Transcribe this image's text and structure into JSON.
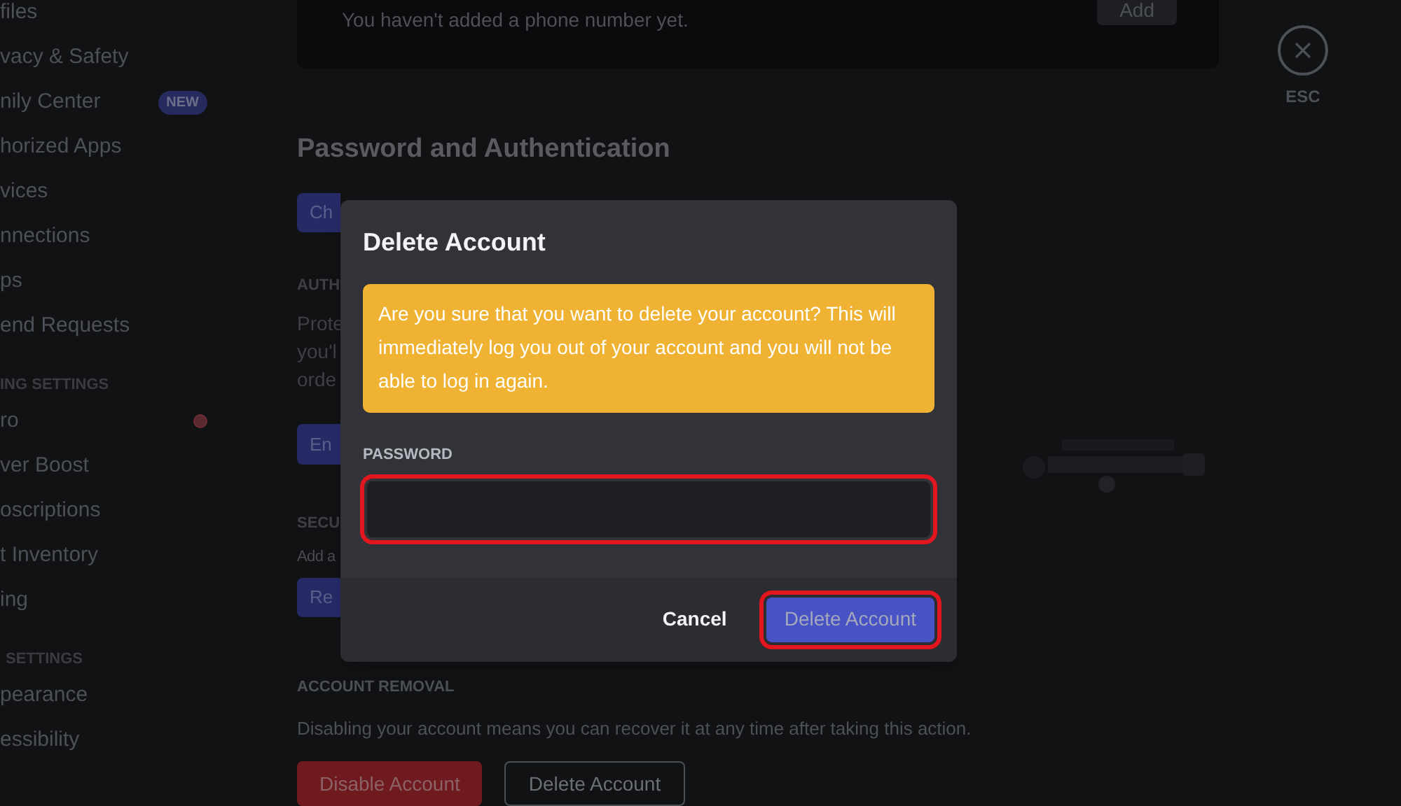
{
  "sidebar": {
    "sections": [
      {
        "items": [
          {
            "label": "files"
          },
          {
            "label": "vacy & Safety"
          },
          {
            "label": "nily Center",
            "badge": "NEW"
          },
          {
            "label": "horized Apps"
          },
          {
            "label": "vices"
          },
          {
            "label": "nnections"
          },
          {
            "label": "ps"
          },
          {
            "label": "end Requests"
          }
        ]
      },
      {
        "header": "ING SETTINGS",
        "items": [
          {
            "label": "ro",
            "alert": true
          },
          {
            "label": "ver Boost"
          },
          {
            "label": "oscriptions"
          },
          {
            "label": "t Inventory"
          },
          {
            "label": "ing"
          }
        ]
      },
      {
        "header": "SETTINGS",
        "items": [
          {
            "label": "pearance"
          },
          {
            "label": "essibility"
          }
        ]
      }
    ]
  },
  "phone_card": {
    "text": "You haven't added a phone number yet.",
    "button": "Add"
  },
  "close": {
    "label": "ESC"
  },
  "password_section": {
    "title": "Password and Authentication",
    "button": "Ch",
    "auth_label": "AUTH",
    "auth_text": [
      "Prote",
      "you'l",
      "orde"
    ],
    "enable_button": "En",
    "security_label": "SECU",
    "security_text": "Add a",
    "security_button": "Re"
  },
  "account_removal": {
    "label": "ACCOUNT REMOVAL",
    "text": "Disabling your account means you can recover it at any time after taking this action.",
    "buttons": [
      {
        "label": "Disable Account",
        "kind": "danger"
      },
      {
        "label": "Delete Account",
        "kind": "outline"
      }
    ]
  },
  "dialog": {
    "title": "Delete Account",
    "warning": "Are you sure that you want to delete your account? This will immediately log you out of your account and you will not be able to log in again.",
    "field": {
      "label": "PASSWORD",
      "highlighted": true
    },
    "cancel": "Cancel",
    "confirm": {
      "label": "Delete Account",
      "disabled": true,
      "highlighted": true
    }
  }
}
